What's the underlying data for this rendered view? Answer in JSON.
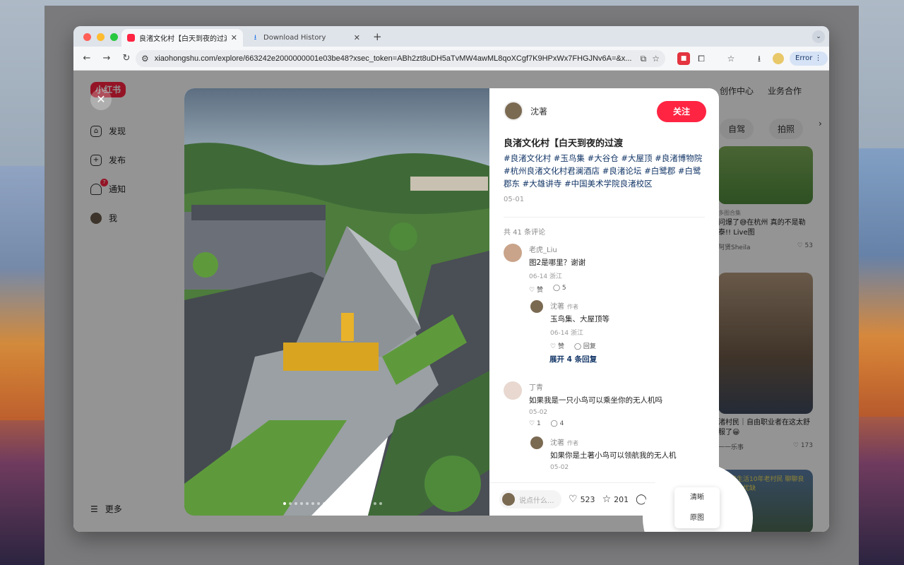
{
  "browser": {
    "tabs": [
      {
        "title": "良渚文化村【白天到夜的过渡 -"
      },
      {
        "title": "Download History"
      }
    ],
    "new_tab": "+",
    "url": "xiaohongshu.com/explore/663242e2000000001e03be48?xsec_token=ABh2zt8uDH5aTvMW4awML8qoXCgf7K9HPxWx7FHGJNv6A=&x...",
    "error_label": "Error"
  },
  "sidebar": {
    "logo": "小红书",
    "items": [
      {
        "label": "发现"
      },
      {
        "label": "发布"
      },
      {
        "label": "通知",
        "badge": "7"
      },
      {
        "label": "我"
      }
    ],
    "more": "更多"
  },
  "topnav": {
    "links": [
      "创作中心",
      "业务合作"
    ]
  },
  "chips": [
    "自驾",
    "拍照",
    "›"
  ],
  "feed": [
    {
      "tag": "多图合集",
      "title": "问爆了😅在杭州 真的不是勒泰!! Live图",
      "author": "阿贤Sheila",
      "likes": "53"
    },
    {
      "title": "渚村民｜自由职业者在这太舒服了😀",
      "author": "一一乐事",
      "likes": "173"
    },
    {
      "title": "良渚生活10年老村民 聊聊良渚居住优缺"
    }
  ],
  "note": {
    "author": "沈著",
    "follow": "关注",
    "title": "良渚文化村【白天到夜的过渡",
    "tags": "#良渚文化村 #玉鸟集 #大谷仓 #大屋顶 #良渚博物院 #杭州良渚文化村君澜酒店 #良渚论坛 #白鹭郡 #白鹭郡东 #大雄讲寺 #中国美术学院良渚校区",
    "date": "05-01",
    "comment_count": "共 41 条评论",
    "comments": [
      {
        "name": "老虎_Liu",
        "text": "图2是哪里？谢谢",
        "meta": "06-14 浙江",
        "like": "赞",
        "reply_count": "5"
      },
      {
        "name": "沈著",
        "author_tag": "作者",
        "text": "玉鸟集、大屋顶等",
        "meta": "06-14 浙江",
        "like": "赞",
        "reply": "回复"
      },
      {
        "name": "丁青",
        "text": "如果我是一只小鸟可以乘坐你的无人机吗",
        "meta": "05-02",
        "like": "1",
        "reply_count": "4"
      },
      {
        "name": "沈著",
        "author_tag": "作者",
        "text": "如果你是土著小鸟可以领航我的无人机",
        "meta": "05-02"
      }
    ],
    "expand_replies": "展开 4 条回复",
    "input_placeholder": "说点什么...",
    "likes": "523",
    "stars": "201",
    "comments_total": "41"
  },
  "download_menu": {
    "options": [
      "清晰",
      "原图"
    ]
  },
  "icons": {
    "accent": "#ff2442",
    "link": "#133667"
  }
}
